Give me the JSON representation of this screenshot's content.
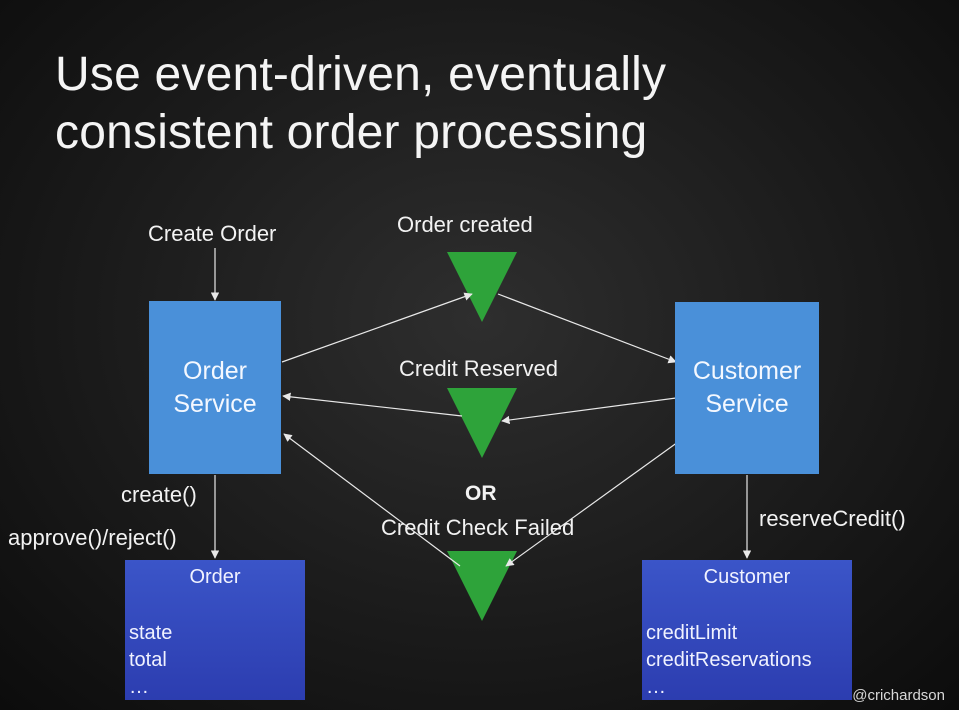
{
  "slide": {
    "title_line1": "Use event-driven, eventually",
    "title_line2": "consistent order processing",
    "handle": "@crichardson"
  },
  "labels": {
    "create_order": "Create Order",
    "order_created": "Order created",
    "credit_reserved": "Credit Reserved",
    "or": "OR",
    "credit_check_failed": "Credit Check Failed",
    "create": "create()",
    "approve_reject": "approve()/reject()",
    "reserve_credit": "reserveCredit()"
  },
  "services": {
    "order_line1": "Order",
    "order_line2": "Service",
    "customer_line1": "Customer",
    "customer_line2": "Service"
  },
  "entities": {
    "order": {
      "name": "Order",
      "fields": [
        "state",
        "total",
        "…"
      ]
    },
    "customer": {
      "name": "Customer",
      "fields": [
        "creditLimit",
        "creditReservations",
        "…"
      ]
    }
  },
  "colors": {
    "service": "#4a90d9",
    "entity": "#3347bd",
    "event": "#2ea33a",
    "arrow": "#e8e8e8"
  }
}
